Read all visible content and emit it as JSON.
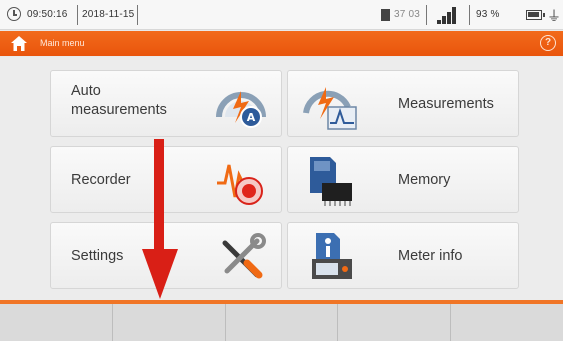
{
  "status_bar": {
    "time": "09:50:16",
    "date": "2018-11-15",
    "memory_free": "37 03",
    "battery_percent": "93 %",
    "clock_icon": "clock-icon",
    "sd_card_icon": "sd-card-icon",
    "signal_icon": "signal-strength-icon",
    "battery_icon": "battery-icon",
    "plug_icon": "plug-icon"
  },
  "header": {
    "title": "Main menu",
    "home_icon": "home-icon",
    "help_icon": "help-icon",
    "help_glyph": "?",
    "accent_color": "#ef6114"
  },
  "menu": {
    "auto_measurements": {
      "line1": "Auto",
      "line2": "measurements",
      "icon": "auto-measurements-icon"
    },
    "measurements": {
      "label": "Measurements",
      "icon": "measurements-icon"
    },
    "recorder": {
      "label": "Recorder",
      "icon": "recorder-icon"
    },
    "memory": {
      "label": "Memory",
      "icon": "memory-icon"
    },
    "settings": {
      "label": "Settings",
      "icon": "settings-icon"
    },
    "meter_info": {
      "label": "Meter info",
      "icon": "meter-info-icon"
    }
  },
  "overlay": {
    "arrow_icon": "down-arrow-icon",
    "arrow_color": "#d91f16"
  },
  "softkeys": [
    "",
    "",
    "",
    "",
    ""
  ]
}
